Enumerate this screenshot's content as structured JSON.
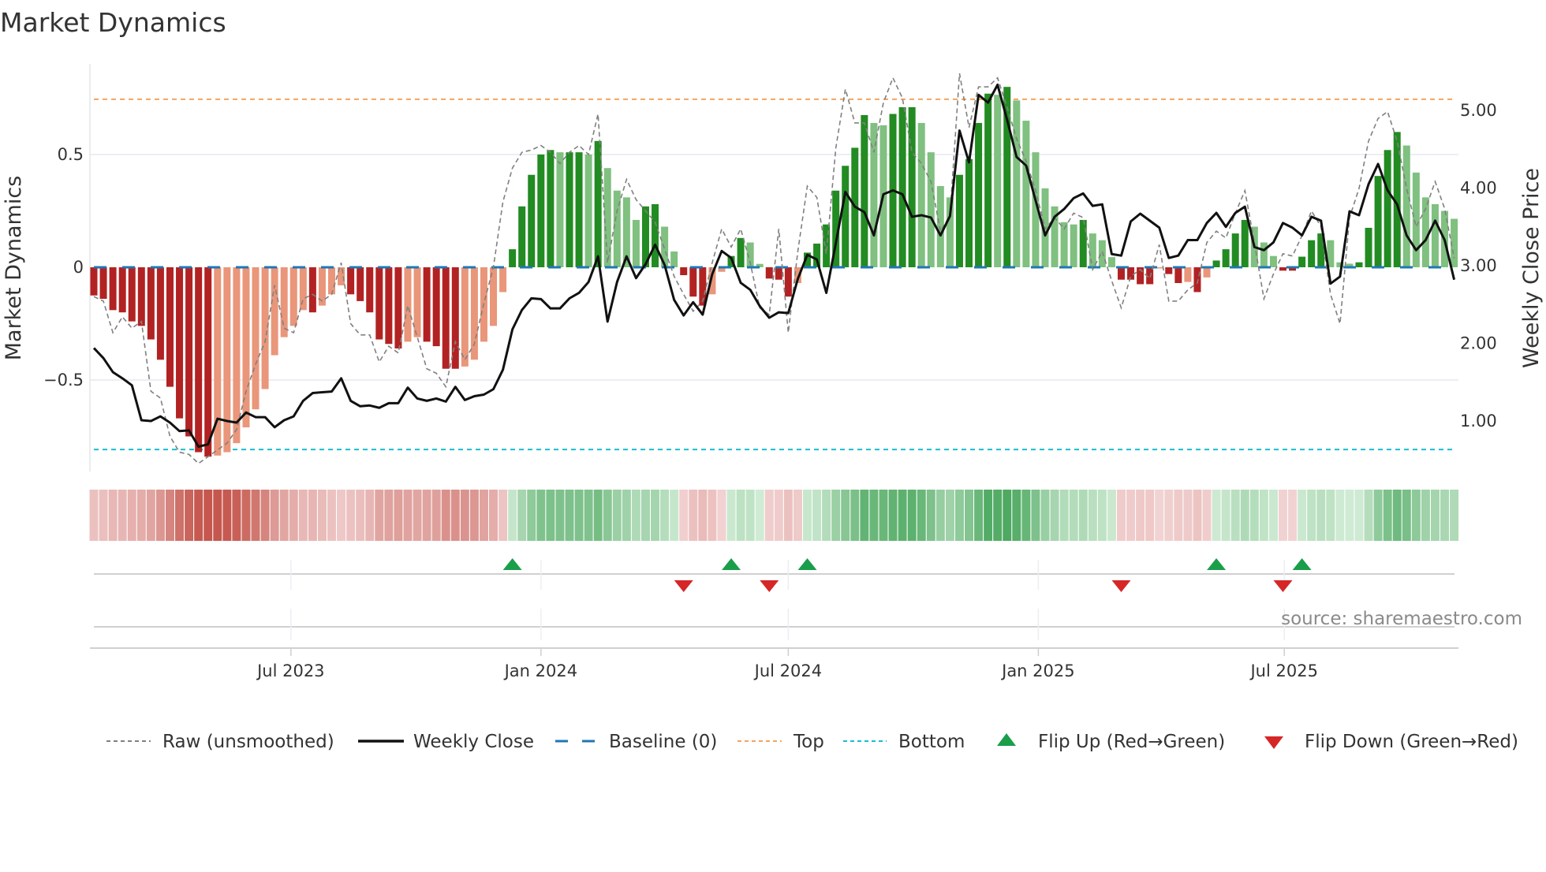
{
  "chart_data": {
    "type": "bar",
    "title": "Market Dynamics",
    "ylabel": "Market Dynamics",
    "ylabel_right": "Weekly Close Price",
    "source": "source: sharemaestro.com",
    "start_week": "2023-02-06",
    "frequency": "weekly",
    "ylim": [
      -0.9,
      0.9
    ],
    "ylim_right": [
      0.0,
      5.6
    ],
    "yticks": [
      {
        "v": 0.5,
        "label": "0.5"
      },
      {
        "v": 0,
        "label": "0"
      },
      {
        "v": -0.5,
        "label": "−0.5"
      }
    ],
    "yticks_right": [
      {
        "v": 5,
        "label": "5.00"
      },
      {
        "v": 4,
        "label": "4.00"
      },
      {
        "v": 3,
        "label": "3.00"
      },
      {
        "v": 2,
        "label": "2.00"
      },
      {
        "v": 1,
        "label": "1.00"
      }
    ],
    "xticks": [
      {
        "date": "2023-07-01",
        "label": "Jul 2023"
      },
      {
        "date": "2024-01-01",
        "label": "Jan 2024"
      },
      {
        "date": "2024-07-01",
        "label": "Jul 2024"
      },
      {
        "date": "2025-01-01",
        "label": "Jan 2025"
      },
      {
        "date": "2025-07-01",
        "label": "Jul 2025"
      }
    ],
    "levels": {
      "top": 0.745,
      "bottom": -0.808,
      "baseline": 0
    },
    "colors": {
      "up_strong": "#228b22",
      "up_weak": "#80c080",
      "down_strong": "#b22222",
      "down_weak": "#e9967a",
      "raw": "#808080",
      "close": "#111111",
      "baseline": "#1f77b4",
      "top": "#f4a460",
      "bottom": "#17becf",
      "flip_up": "#1a9e4a",
      "flip_down": "#d62728"
    },
    "dynamics": [
      -0.125,
      -0.14,
      -0.19,
      -0.2,
      -0.24,
      -0.26,
      -0.32,
      -0.41,
      -0.53,
      -0.67,
      -0.75,
      -0.82,
      -0.84,
      -0.835,
      -0.82,
      -0.78,
      -0.71,
      -0.63,
      -0.54,
      -0.39,
      -0.31,
      -0.26,
      -0.19,
      -0.2,
      -0.17,
      -0.12,
      -0.08,
      -0.12,
      -0.15,
      -0.2,
      -0.32,
      -0.34,
      -0.36,
      -0.33,
      -0.31,
      -0.33,
      -0.35,
      -0.45,
      -0.45,
      -0.44,
      -0.41,
      -0.33,
      -0.26,
      -0.11,
      0.08,
      0.27,
      0.41,
      0.5,
      0.52,
      0.51,
      0.51,
      0.51,
      0.5,
      0.56,
      0.44,
      0.34,
      0.31,
      0.21,
      0.27,
      0.28,
      0.18,
      0.07,
      -0.035,
      -0.13,
      -0.17,
      -0.12,
      -0.02,
      0.05,
      0.13,
      0.11,
      0.015,
      -0.05,
      -0.055,
      -0.13,
      -0.07,
      0.065,
      0.105,
      0.19,
      0.34,
      0.45,
      0.53,
      0.675,
      0.64,
      0.63,
      0.68,
      0.71,
      0.71,
      0.64,
      0.51,
      0.36,
      0.31,
      0.41,
      0.48,
      0.64,
      0.77,
      0.765,
      0.8,
      0.74,
      0.65,
      0.51,
      0.35,
      0.27,
      0.2,
      0.19,
      0.21,
      0.15,
      0.12,
      0.045,
      -0.055,
      -0.055,
      -0.075,
      -0.075,
      -0.005,
      -0.03,
      -0.07,
      -0.065,
      -0.11,
      -0.045,
      0.03,
      0.08,
      0.15,
      0.21,
      0.18,
      0.11,
      0.05,
      -0.015,
      -0.015,
      0.047,
      0.12,
      0.15,
      0.12,
      0.022,
      0.016,
      0.022,
      0.175,
      0.405,
      0.52,
      0.6,
      0.54,
      0.42,
      0.31,
      0.28,
      0.25,
      0.215
    ],
    "raw": [
      -0.13,
      -0.15,
      -0.29,
      -0.22,
      -0.27,
      -0.24,
      -0.55,
      -0.58,
      -0.75,
      -0.82,
      -0.83,
      -0.87,
      -0.84,
      -0.81,
      -0.78,
      -0.72,
      -0.55,
      -0.43,
      -0.33,
      -0.08,
      -0.27,
      -0.29,
      -0.14,
      -0.12,
      -0.15,
      -0.12,
      0.02,
      -0.25,
      -0.3,
      -0.3,
      -0.42,
      -0.35,
      -0.38,
      -0.17,
      -0.31,
      -0.45,
      -0.47,
      -0.53,
      -0.33,
      -0.41,
      -0.34,
      -0.16,
      0.0,
      0.29,
      0.44,
      0.51,
      0.52,
      0.54,
      0.51,
      0.46,
      0.51,
      0.54,
      0.5,
      0.68,
      0.02,
      0.25,
      0.39,
      0.3,
      0.25,
      0.2,
      0.08,
      -0.04,
      -0.12,
      -0.195,
      -0.15,
      0.02,
      0.17,
      0.09,
      0.17,
      0.02,
      -0.18,
      -0.21,
      0.17,
      -0.29,
      0.07,
      0.36,
      0.31,
      0.06,
      0.53,
      0.79,
      0.64,
      0.64,
      0.51,
      0.73,
      0.84,
      0.75,
      0.51,
      0.46,
      0.38,
      0.16,
      0.23,
      0.86,
      0.62,
      0.8,
      0.8,
      0.84,
      0.71,
      0.57,
      0.47,
      0.34,
      0.17,
      0.22,
      0.17,
      0.24,
      0.22,
      -0.01,
      0.07,
      -0.06,
      -0.18,
      -0.04,
      -0.01,
      -0.05,
      0.1,
      -0.15,
      -0.15,
      -0.1,
      -0.07,
      0.11,
      0.16,
      0.13,
      0.24,
      0.34,
      0.11,
      -0.14,
      -0.03,
      0.06,
      0.05,
      0.14,
      0.25,
      0.18,
      -0.12,
      -0.25,
      0.22,
      0.35,
      0.56,
      0.66,
      0.69,
      0.56,
      0.35,
      0.18,
      0.26,
      0.38,
      0.26,
      0.04
    ],
    "close": [
      1.94,
      1.81,
      1.63,
      1.55,
      1.46,
      1.01,
      1.0,
      1.06,
      0.98,
      0.87,
      0.88,
      0.67,
      0.7,
      1.03,
      1.0,
      0.98,
      1.11,
      1.05,
      1.05,
      0.92,
      1.01,
      1.06,
      1.26,
      1.36,
      1.37,
      1.38,
      1.55,
      1.26,
      1.19,
      1.2,
      1.17,
      1.23,
      1.23,
      1.43,
      1.29,
      1.26,
      1.29,
      1.25,
      1.44,
      1.27,
      1.32,
      1.34,
      1.41,
      1.66,
      2.18,
      2.43,
      2.58,
      2.57,
      2.45,
      2.45,
      2.58,
      2.65,
      2.79,
      3.12,
      2.28,
      2.79,
      3.12,
      2.84,
      3.02,
      3.27,
      3.01,
      2.56,
      2.36,
      2.53,
      2.37,
      2.89,
      3.19,
      3.1,
      2.78,
      2.69,
      2.48,
      2.33,
      2.4,
      2.39,
      2.83,
      3.14,
      3.08,
      2.65,
      3.29,
      3.95,
      3.76,
      3.69,
      3.39,
      3.92,
      3.97,
      3.92,
      3.63,
      3.65,
      3.62,
      3.39,
      3.64,
      4.74,
      4.33,
      5.2,
      5.1,
      5.33,
      4.88,
      4.4,
      4.29,
      3.84,
      3.39,
      3.63,
      3.73,
      3.87,
      3.93,
      3.77,
      3.79,
      3.15,
      3.13,
      3.57,
      3.67,
      3.58,
      3.49,
      3.1,
      3.13,
      3.33,
      3.33,
      3.55,
      3.68,
      3.5,
      3.68,
      3.76,
      3.24,
      3.2,
      3.3,
      3.55,
      3.49,
      3.39,
      3.63,
      3.58,
      2.77,
      2.86,
      3.7,
      3.65,
      4.05,
      4.31,
      3.97,
      3.79,
      3.39,
      3.2,
      3.33,
      3.58,
      3.33,
      2.82
    ],
    "flips_up": [
      "2023-12-11",
      "2024-05-20",
      "2024-07-15",
      "2025-05-12",
      "2025-07-14"
    ],
    "flips_down": [
      "2024-04-15",
      "2024-06-17",
      "2025-03-03",
      "2025-06-30"
    ],
    "legend": {
      "placement": "bottom",
      "raw": "Raw (unsmoothed)",
      "close": "Weekly Close",
      "baseline": "Baseline (0)",
      "top": "Top",
      "bottom": "Bottom",
      "flip_up": "Flip Up (Red→Green)",
      "flip_down": "Flip Down (Green→Red)"
    }
  }
}
